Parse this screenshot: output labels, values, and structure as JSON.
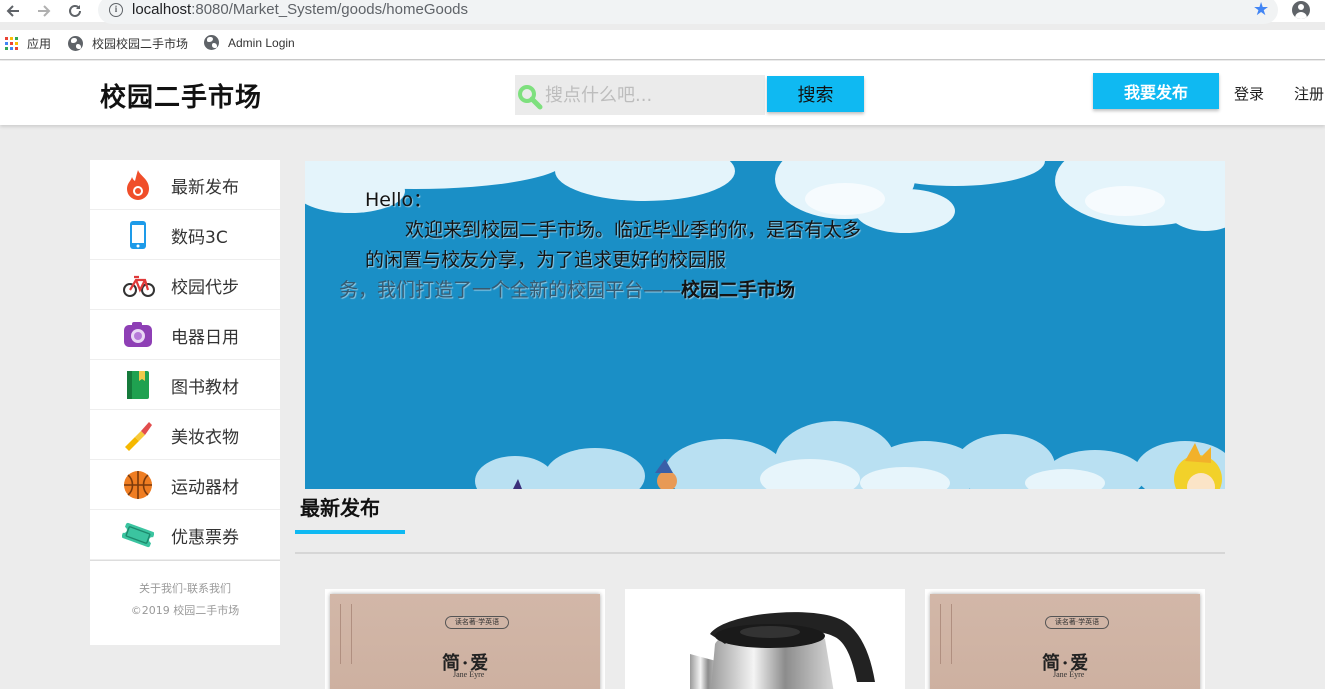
{
  "browser": {
    "url_host": "localhost",
    "url_path": ":8080/Market_System/goods/homeGoods",
    "bookmarks": [
      {
        "label": "应用"
      },
      {
        "label": "校园校园二手市场"
      },
      {
        "label": "Admin Login"
      }
    ]
  },
  "header": {
    "logo": "校园二手市场",
    "search_placeholder": "搜点什么吧...",
    "search_button": "搜索",
    "publish_button": "我要发布",
    "login": "登录",
    "register": "注册"
  },
  "sidebar": {
    "items": [
      {
        "label": "最新发布",
        "icon": "fire-icon"
      },
      {
        "label": "数码3C",
        "icon": "phone-icon"
      },
      {
        "label": "校园代步",
        "icon": "bicycle-icon"
      },
      {
        "label": "电器日用",
        "icon": "camera-icon"
      },
      {
        "label": "图书教材",
        "icon": "book-icon"
      },
      {
        "label": "美妆衣物",
        "icon": "lipstick-icon"
      },
      {
        "label": "运动器材",
        "icon": "basketball-icon"
      },
      {
        "label": "优惠票券",
        "icon": "ticket-icon"
      }
    ],
    "footer_links": "关于我们-联系我们",
    "copyright": "©2019 校园二手市场"
  },
  "banner": {
    "greeting": "Hello：",
    "line1": "欢迎来到校园二手市场。临近毕业季的你，是否有太多",
    "line2": "的闲置与校友分享，为了追求更好的校园服",
    "line3_prefix": "务，我们打造了一个全新的校园平台——",
    "line3_bold": "校园二手市场"
  },
  "section": {
    "title": "最新发布"
  },
  "products": [
    {
      "type": "book",
      "tag": "读名著·学英语",
      "title": "简·爱",
      "subtitle": "Jane Eyre"
    },
    {
      "type": "kettle"
    },
    {
      "type": "book",
      "tag": "读名著·学英语",
      "title": "简·爱",
      "subtitle": "Jane Eyre"
    }
  ],
  "colors": {
    "accent": "#0fb9f2",
    "banner_sky": "#1a8fc6",
    "page_bg": "#ececec"
  }
}
